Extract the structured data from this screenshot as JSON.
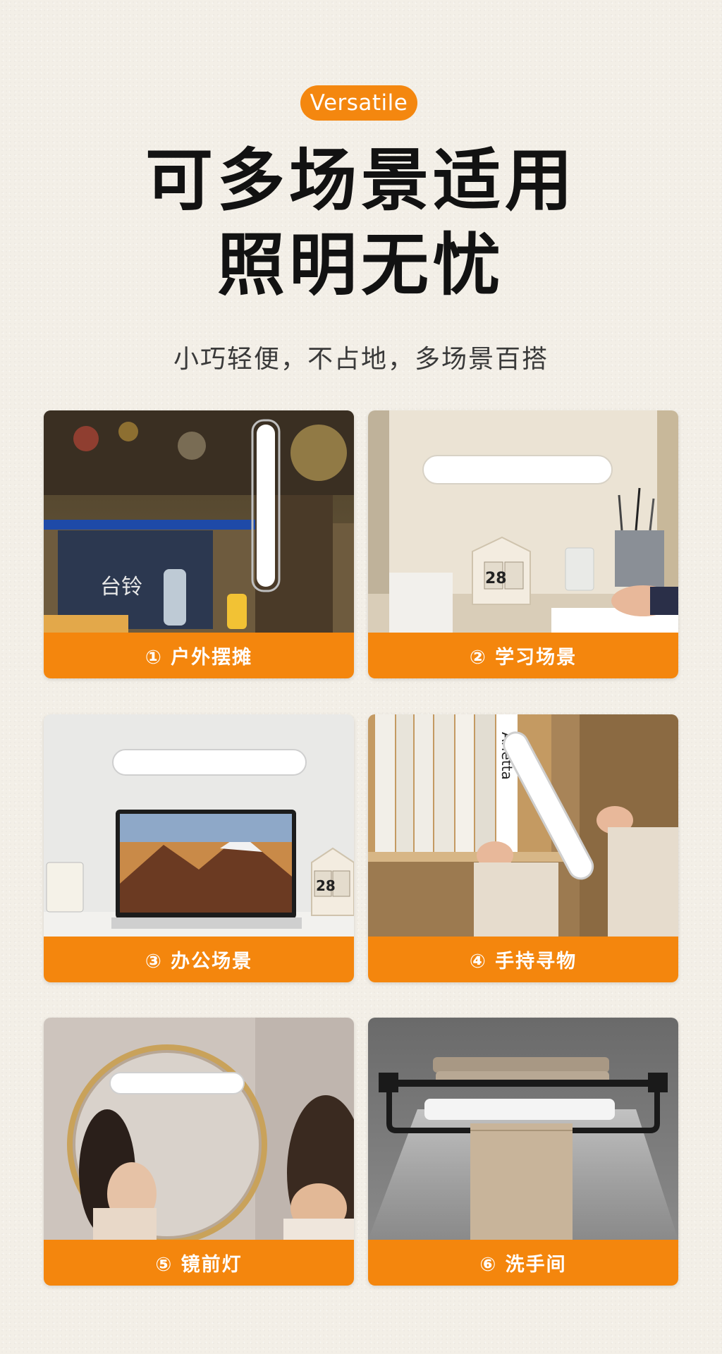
{
  "header": {
    "badge": "Versatile",
    "title_line1": "可多场景适用",
    "title_line2": "照明无忧",
    "subtitle": "小巧轻便，不占地，多场景百搭"
  },
  "accent_color": "#f4860d",
  "scenes": [
    {
      "label": "① 户外摆摊",
      "sign_text": "台铃",
      "calendar": ""
    },
    {
      "label": "② 学习场景",
      "calendar": "28"
    },
    {
      "label": "③ 办公场景",
      "calendar": "28"
    },
    {
      "label": "④ 手持寻物",
      "book_text": "Arletta"
    },
    {
      "label": "⑤ 镜前灯"
    },
    {
      "label": "⑥ 洗手间"
    }
  ]
}
